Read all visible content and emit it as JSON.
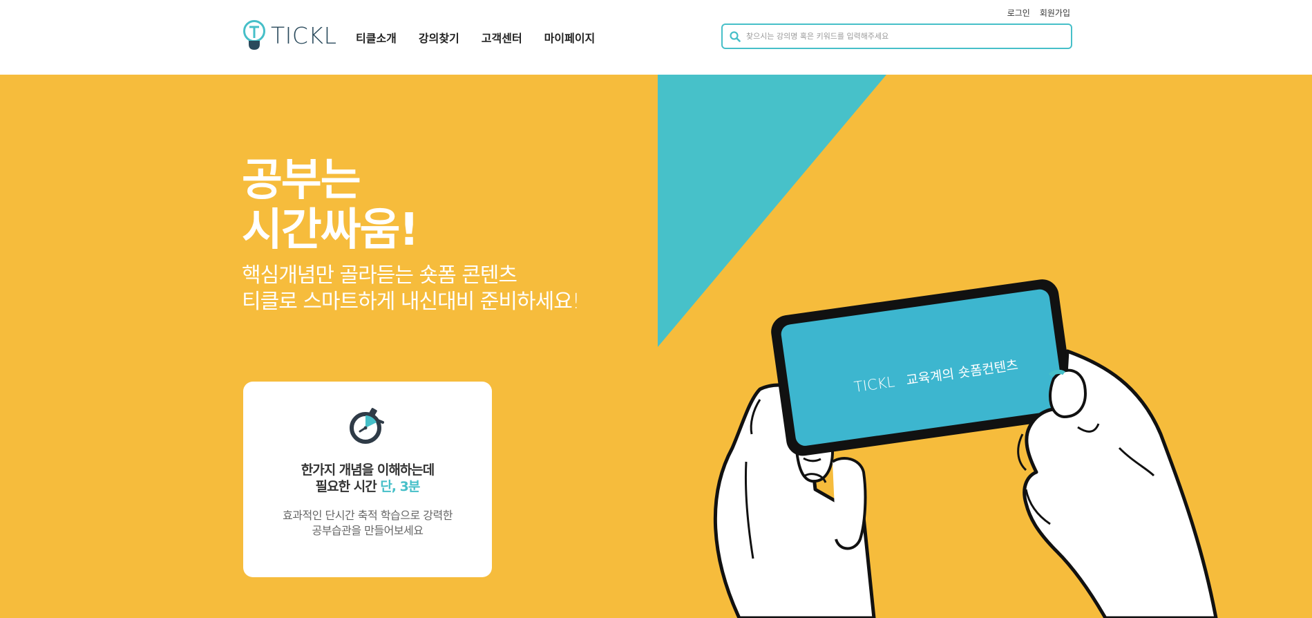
{
  "header": {
    "logo_text": "TICKL",
    "nav": [
      "티클소개",
      "강의찾기",
      "고객센터",
      "마이페이지"
    ],
    "util": {
      "login": "로그인",
      "signup": "회원가입"
    },
    "search": {
      "placeholder": "찾으시는 강의명 혹은 키워드를 입력해주세요",
      "value": ""
    }
  },
  "hero": {
    "headline_line1": "공부는",
    "headline_line2": "시간싸움!",
    "sub_line1": "핵심개념만 골라듣는 숏폼 콘텐츠",
    "sub_line2": "티클로 스마트하게 내신대비 준비하세요!",
    "phone_brand": "TICKL",
    "phone_text": "교육계의 숏폼컨텐츠"
  },
  "card": {
    "title_line1": "한가지 개념을 이해하는데",
    "title_line2_prefix": "필요한 시간",
    "title_line2_accent": "단, 3분",
    "desc_line1": "효과적인 단시간 축적 학습으로 강력한",
    "desc_line2": "공부습관을 만들어보세요"
  },
  "colors": {
    "accent": "#46bfc8",
    "hero_bg": "#f6bc3c",
    "phone_screen": "#3db6cf",
    "dark": "#2a4a5c"
  }
}
